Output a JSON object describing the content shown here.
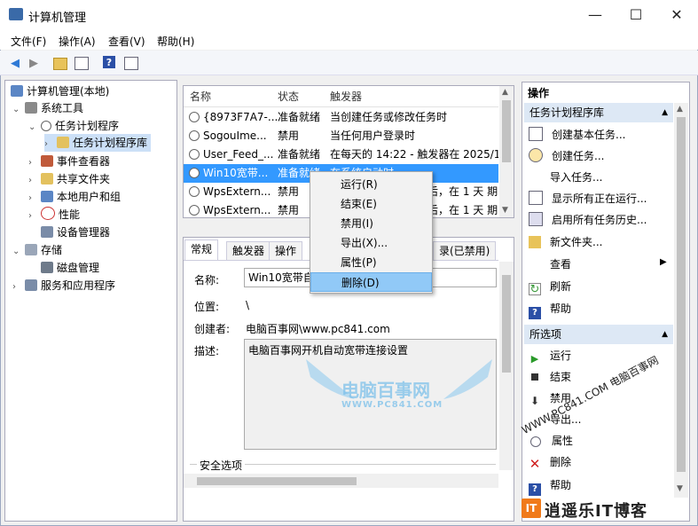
{
  "window": {
    "title": "计算机管理"
  },
  "menubar": [
    "文件(F)",
    "操作(A)",
    "查看(V)",
    "帮助(H)"
  ],
  "tree": {
    "root": "计算机管理(本地)",
    "system_tools": "系统工具",
    "task_scheduler": "任务计划程序",
    "task_library": "任务计划程序库",
    "event_viewer": "事件查看器",
    "shared_folders": "共享文件夹",
    "local_users": "本地用户和组",
    "performance": "性能",
    "device_manager": "设备管理器",
    "storage": "存储",
    "disk_mgmt": "磁盘管理",
    "services": "服务和应用程序"
  },
  "task_list": {
    "headers": [
      "名称",
      "状态",
      "触发器"
    ],
    "rows": [
      {
        "name": "{8973F7A7-...",
        "status": "准备就绪",
        "trigger": "当创建任务或修改任务时"
      },
      {
        "name": "SogouIme...",
        "status": "禁用",
        "trigger": "当任何用户登录时"
      },
      {
        "name": "User_Feed_...",
        "status": "准备就绪",
        "trigger": "在每天的 14:22 - 触发器在 2025/1"
      },
      {
        "name": "Win10宽带...",
        "status": "准备就绪",
        "trigger": "在系统启动时"
      },
      {
        "name": "WpsExtern...",
        "status": "禁用",
        "trigger": "后，在 1 天 期"
      },
      {
        "name": "WpsExtern...",
        "status": "禁用",
        "trigger": "后，在 1 天 期"
      }
    ]
  },
  "context_menu": [
    "运行(R)",
    "结束(E)",
    "禁用(I)",
    "导出(X)...",
    "属性(P)",
    "删除(D)"
  ],
  "details": {
    "tabs": [
      "常规",
      "触发器",
      "操作",
      "录(已禁用)"
    ],
    "name_label": "名称:",
    "name_value": "Win10宽带自",
    "location_label": "位置:",
    "location_value": "\\",
    "author_label": "创建者:",
    "author_value": "电脑百事网\\www.pc841.com",
    "desc_label": "描述:",
    "desc_value": "电脑百事网开机自动宽带连接设置",
    "security_label": "安全选项"
  },
  "actions": {
    "header": "操作",
    "section1": "任务计划程序库",
    "items1": [
      "创建基本任务...",
      "创建任务...",
      "导入任务...",
      "显示所有正在运行...",
      "启用所有任务历史...",
      "新文件夹...",
      "查看",
      "刷新",
      "帮助"
    ],
    "section2": "所选项",
    "items2": [
      "运行",
      "结束",
      "禁用",
      "导出...",
      "属性",
      "删除",
      "帮助"
    ]
  },
  "watermarks": {
    "center": "电脑百事网",
    "center_url": "WWW.PC841.COM",
    "diagonal": "WWW.PC841.COM 电脑百事网",
    "brand": "逍遥乐IT博客"
  }
}
